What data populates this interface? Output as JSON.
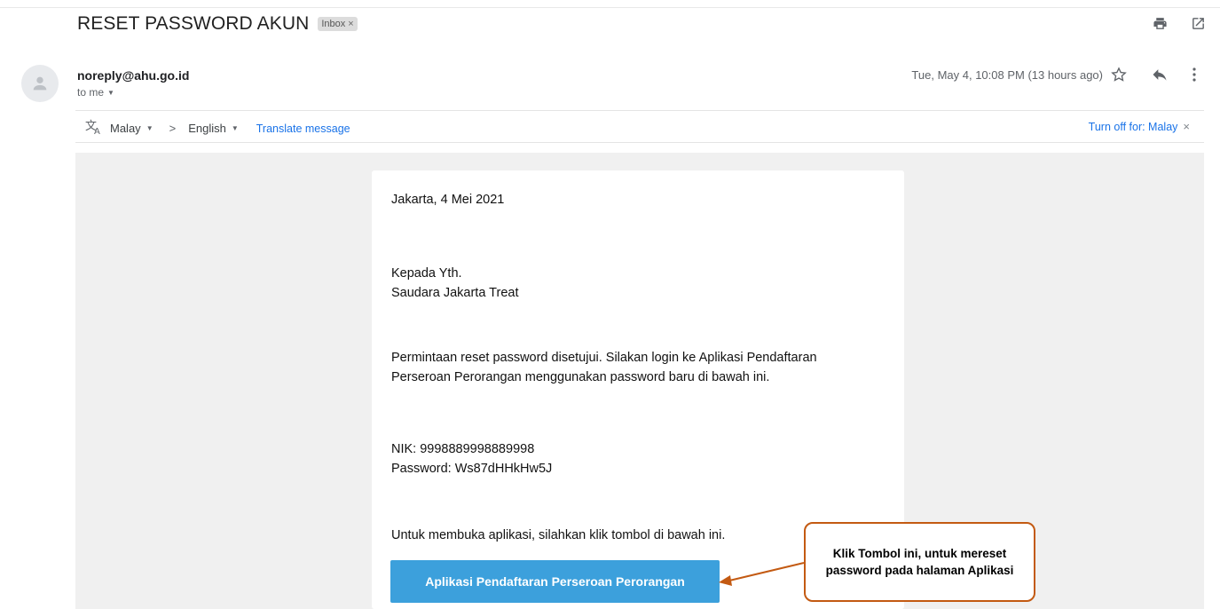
{
  "subject": {
    "title": "RESET PASSWORD AKUN",
    "label": "Inbox",
    "label_close": "×"
  },
  "sender": {
    "email": "noreply@ahu.go.id",
    "to": "to me",
    "date": "Tue, May 4, 10:08 PM (13 hours ago)"
  },
  "translate": {
    "from_lang": "Malay",
    "arrow": ">",
    "to_lang": "English",
    "translate_link": "Translate message",
    "turn_off": "Turn off for: Malay",
    "turn_off_close": "×"
  },
  "email": {
    "date_line": "Jakarta, 4 Mei 2021",
    "greeting_1": "Kepada Yth.",
    "greeting_2": "Saudara Jakarta Treat",
    "message_1": "Permintaan reset password disetujui. Silakan login ke Aplikasi Pendaftaran",
    "message_2": "Perseroan Perorangan menggunakan password baru di bawah ini.",
    "nik": "NIK: 9998889998889998",
    "password": "Password: Ws87dHHkHw5J",
    "open_app": "Untuk membuka aplikasi, silahkan klik tombol di bawah ini.",
    "button_label": "Aplikasi Pendaftaran Perseroan Perorangan"
  },
  "annotation": {
    "line_1": "Klik Tombol ini, untuk mereset",
    "line_2": "password pada halaman Aplikasi"
  },
  "colors": {
    "button": "#3ca0dc",
    "link": "#1a73e8",
    "annotation_border": "#c35a12"
  },
  "icons": [
    "print-icon",
    "open-new-window-icon",
    "avatar-person-icon",
    "star-icon",
    "reply-icon",
    "more-vert-icon",
    "translate-icon"
  ]
}
